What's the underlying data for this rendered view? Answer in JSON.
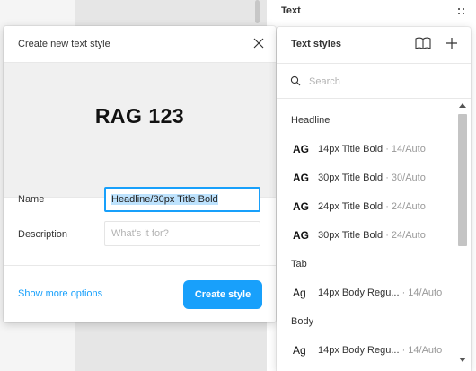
{
  "sidebar": {
    "header": "Text"
  },
  "modal": {
    "title": "Create new text style",
    "preview_text": "RAG 123",
    "name_label": "Name",
    "name_value": "Headline/30px Title Bold",
    "description_label": "Description",
    "description_placeholder": "What's it for?",
    "more_options": "Show more options",
    "create_button": "Create style"
  },
  "styles_panel": {
    "title": "Text styles",
    "search_placeholder": "Search",
    "groups": [
      {
        "label": "Headline",
        "items": [
          {
            "glyph": "AG",
            "name": "14px Title Bold",
            "meta": " · 14/Auto"
          },
          {
            "glyph": "AG",
            "name": "30px Title Bold",
            "meta": " · 30/Auto"
          },
          {
            "glyph": "AG",
            "name": "24px Title Bold",
            "meta": " · 24/Auto"
          },
          {
            "glyph": "AG",
            "name": "30px Title Bold",
            "meta": " · 24/Auto"
          }
        ]
      },
      {
        "label": "Tab",
        "items": [
          {
            "glyph": "Ag",
            "name": "14px Body Regu...",
            "meta": " · 14/Auto"
          }
        ]
      },
      {
        "label": "Body",
        "items": [
          {
            "glyph": "Ag",
            "name": "14px Body Regu...",
            "meta": " · 14/Auto"
          }
        ]
      }
    ]
  },
  "colors": {
    "accent": "#18a0fb",
    "selection": "#bde2fd"
  },
  "icons": [
    "drag-handle-icon",
    "close-icon",
    "book-icon",
    "plus-icon",
    "search-icon",
    "scroll-up-icon",
    "scroll-down-icon"
  ]
}
